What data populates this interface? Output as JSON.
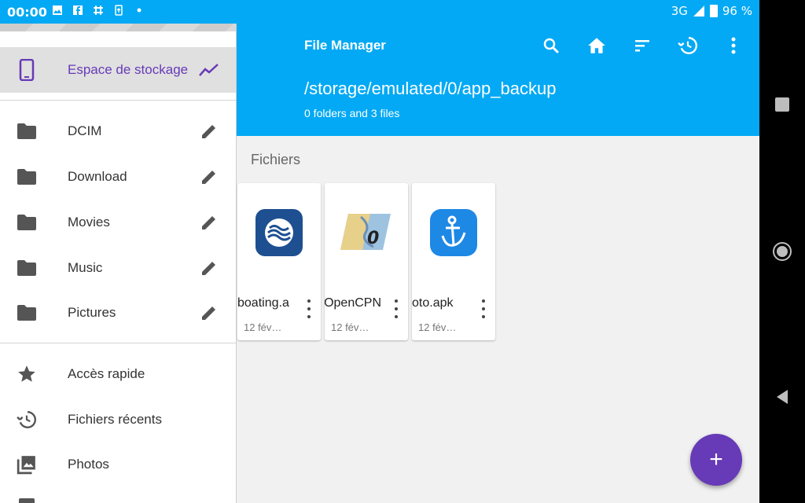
{
  "status": {
    "time": "00:00",
    "network": "3G",
    "battery": "96 %",
    "icons": [
      "image-icon",
      "facebook-icon",
      "slack-icon",
      "sync-icon",
      "dot-icon"
    ]
  },
  "app": {
    "title": "File Manager",
    "path": "/storage/emulated/0/app_backup",
    "subtitle": "0 folders and 3 files",
    "actions": [
      "search-icon",
      "home-icon",
      "sort-icon",
      "history-icon",
      "more-vert-icon"
    ]
  },
  "drawer": {
    "storage_label": "Espace de stockage",
    "folders": [
      {
        "label": "DCIM"
      },
      {
        "label": "Download"
      },
      {
        "label": "Movies"
      },
      {
        "label": "Music"
      },
      {
        "label": "Pictures"
      }
    ],
    "shortcuts": [
      {
        "label": "Accès rapide",
        "icon": "star-icon"
      },
      {
        "label": "Fichiers récents",
        "icon": "history-icon"
      },
      {
        "label": "Photos",
        "icon": "photos-icon"
      }
    ]
  },
  "main": {
    "section_label": "Fichiers",
    "files": [
      {
        "name": "Navionics boating.apk",
        "shown_name": "boating.a",
        "date": "12 fév…",
        "icon": "navionics-icon"
      },
      {
        "name": "OpenCPN.apk",
        "shown_name": "OpenCPN",
        "date": "12 fév…",
        "icon": "opencpn-icon"
      },
      {
        "name": "oto.apk",
        "shown_name": "oto.apk",
        "date": "12 fév…",
        "icon": "anchor-app-icon"
      }
    ]
  },
  "fab": {
    "label": "+"
  },
  "colors": {
    "primary": "#03a9f4",
    "accent": "#673ab7"
  }
}
